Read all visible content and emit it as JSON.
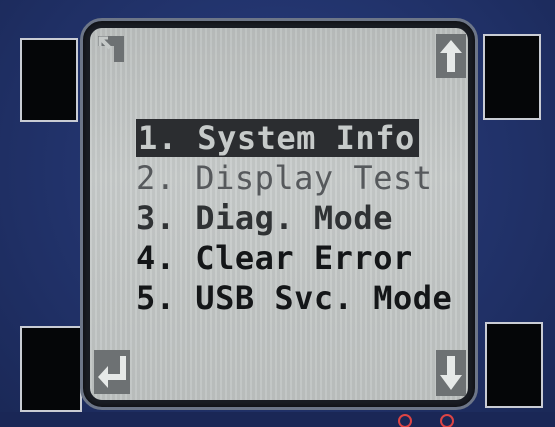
{
  "device": {
    "accent_color": "#233570",
    "lcd_color": "#c5c9c8"
  },
  "icons": {
    "top_left": "back-icon",
    "top_right": "arrow-up-icon",
    "bottom_left": "enter-icon",
    "bottom_right": "arrow-down-icon"
  },
  "menu": {
    "selected_index": 0,
    "items": [
      {
        "label": "1. System Info"
      },
      {
        "label": "2. Display Test"
      },
      {
        "label": "3. Diag. Mode"
      },
      {
        "label": "4. Clear Error"
      },
      {
        "label": "5. USB Svc. Mode"
      }
    ]
  }
}
